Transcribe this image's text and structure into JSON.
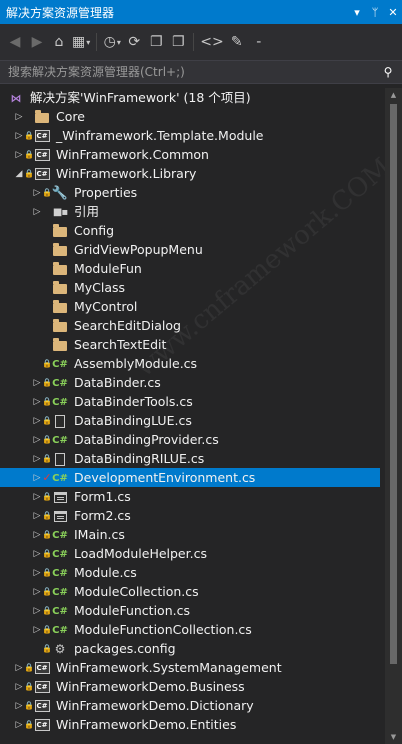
{
  "window": {
    "title": "解决方案资源管理器",
    "dropdown_glyph": "▾",
    "pin_glyph": "ᛘ",
    "close_glyph": "✕"
  },
  "toolbar": {
    "back_glyph": "◀",
    "forward_glyph": "▶",
    "home_glyph": "⌂",
    "switch_view_glyph": "▦",
    "history_glyph": "◷",
    "sync_glyph": "⟳",
    "copy_glyph": "❐",
    "code_glyph": "<>",
    "properties_glyph": "✎",
    "collapse_glyph": "-"
  },
  "search": {
    "placeholder": "搜索解决方案资源管理器(Ctrl+;)",
    "icon_glyph": "⚲"
  },
  "tree": {
    "solution": "解决方案'WinFramework' (18 个项目)",
    "items": [
      {
        "label": "Core",
        "icon": "folder-icon",
        "level": 1,
        "expander": "▷",
        "lock": false
      },
      {
        "label": "_Winframework.Template.Module",
        "icon": "csharp-project-icon",
        "level": 1,
        "expander": "▷",
        "lock": true
      },
      {
        "label": "WinFramework.Common",
        "icon": "csharp-project-icon",
        "level": 1,
        "expander": "▷",
        "lock": true
      },
      {
        "label": "WinFramework.Library",
        "icon": "csharp-project-icon",
        "level": 1,
        "expander": "◢",
        "lock": true
      },
      {
        "label": "Properties",
        "icon": "wrench-icon",
        "level": 2,
        "expander": "▷",
        "lock": true
      },
      {
        "label": "引用",
        "icon": "references-icon",
        "level": 2,
        "expander": "▷",
        "lock": false
      },
      {
        "label": "Config",
        "icon": "folder-icon",
        "level": 2,
        "expander": "",
        "lock": false
      },
      {
        "label": "GridViewPopupMenu",
        "icon": "folder-icon",
        "level": 2,
        "expander": "",
        "lock": false
      },
      {
        "label": "ModuleFun",
        "icon": "folder-icon",
        "level": 2,
        "expander": "",
        "lock": false
      },
      {
        "label": "MyClass",
        "icon": "folder-icon",
        "level": 2,
        "expander": "",
        "lock": false
      },
      {
        "label": "MyControl",
        "icon": "folder-icon",
        "level": 2,
        "expander": "",
        "lock": false
      },
      {
        "label": "SearchEditDialog",
        "icon": "folder-icon",
        "level": 2,
        "expander": "",
        "lock": false
      },
      {
        "label": "SearchTextEdit",
        "icon": "folder-icon",
        "level": 2,
        "expander": "",
        "lock": false
      },
      {
        "label": "AssemblyModule.cs",
        "icon": "csharp-file-icon",
        "level": 2,
        "expander": "",
        "lock": true
      },
      {
        "label": "DataBinder.cs",
        "icon": "csharp-file-icon",
        "level": 2,
        "expander": "▷",
        "lock": true
      },
      {
        "label": "DataBinderTools.cs",
        "icon": "csharp-file-icon",
        "level": 2,
        "expander": "▷",
        "lock": true
      },
      {
        "label": "DataBindingLUE.cs",
        "icon": "file-icon",
        "level": 2,
        "expander": "▷",
        "lock": true
      },
      {
        "label": "DataBindingProvider.cs",
        "icon": "csharp-file-icon",
        "level": 2,
        "expander": "▷",
        "lock": true
      },
      {
        "label": "DataBindingRILUE.cs",
        "icon": "file-icon",
        "level": 2,
        "expander": "▷",
        "lock": true
      },
      {
        "label": "DevelopmentEnvironment.cs",
        "icon": "csharp-file-icon",
        "level": 2,
        "expander": "▷",
        "lock": false,
        "checked": true,
        "selected": true
      },
      {
        "label": "Form1.cs",
        "icon": "form-icon",
        "level": 2,
        "expander": "▷",
        "lock": true
      },
      {
        "label": "Form2.cs",
        "icon": "form-icon",
        "level": 2,
        "expander": "▷",
        "lock": true
      },
      {
        "label": "IMain.cs",
        "icon": "csharp-file-icon",
        "level": 2,
        "expander": "▷",
        "lock": true
      },
      {
        "label": "LoadModuleHelper.cs",
        "icon": "csharp-file-icon",
        "level": 2,
        "expander": "▷",
        "lock": true
      },
      {
        "label": "Module.cs",
        "icon": "csharp-file-icon",
        "level": 2,
        "expander": "▷",
        "lock": true
      },
      {
        "label": "ModuleCollection.cs",
        "icon": "csharp-file-icon",
        "level": 2,
        "expander": "▷",
        "lock": true
      },
      {
        "label": "ModuleFunction.cs",
        "icon": "csharp-file-icon",
        "level": 2,
        "expander": "▷",
        "lock": true
      },
      {
        "label": "ModuleFunctionCollection.cs",
        "icon": "csharp-file-icon",
        "level": 2,
        "expander": "▷",
        "lock": true
      },
      {
        "label": "packages.config",
        "icon": "config-icon",
        "level": 2,
        "expander": "",
        "lock": true
      },
      {
        "label": "WinFramework.SystemManagement",
        "icon": "csharp-project-icon",
        "level": 1,
        "expander": "▷",
        "lock": true
      },
      {
        "label": "WinFrameworkDemo.Business",
        "icon": "csharp-project-icon",
        "level": 1,
        "expander": "▷",
        "lock": true
      },
      {
        "label": "WinFrameworkDemo.Dictionary",
        "icon": "csharp-project-icon",
        "level": 1,
        "expander": "▷",
        "lock": true
      },
      {
        "label": "WinFrameworkDemo.Entities",
        "icon": "csharp-project-icon",
        "level": 1,
        "expander": "▷",
        "lock": true
      }
    ]
  },
  "scrollbar": {
    "up_glyph": "▲",
    "down_glyph": "▼"
  },
  "colors": {
    "accent": "#007acc",
    "background": "#252526",
    "folder": "#dcb67a",
    "csharp": "#8ad15a"
  }
}
